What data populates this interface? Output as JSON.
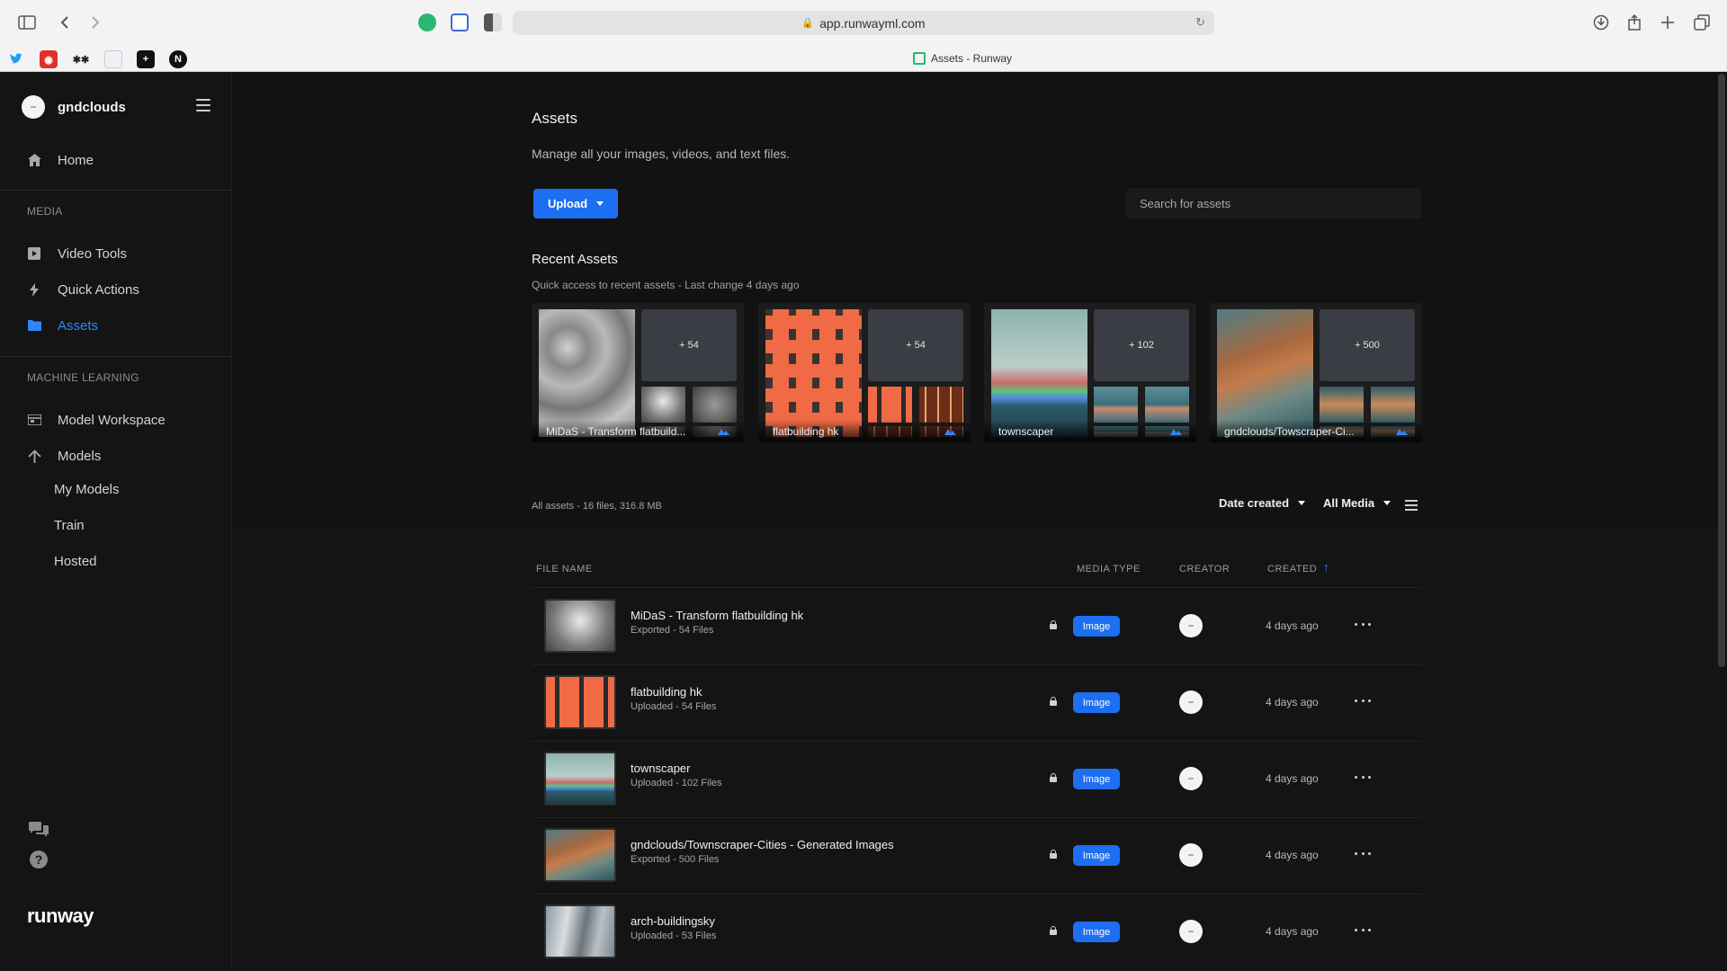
{
  "browser": {
    "url": "app.runwayml.com",
    "tab_title": "Assets - Runway"
  },
  "sidebar": {
    "username": "gndclouds",
    "home": "Home",
    "media_section": "MEDIA",
    "media_items": [
      {
        "label": "Video Tools",
        "icon": "video-icon"
      },
      {
        "label": "Quick Actions",
        "icon": "lightning-icon"
      },
      {
        "label": "Assets",
        "icon": "folder-icon",
        "active": true
      }
    ],
    "ml_section": "MACHINE LEARNING",
    "ml_items": [
      {
        "label": "Model Workspace",
        "icon": "workspace-icon"
      },
      {
        "label": "Models",
        "icon": "models-icon"
      }
    ],
    "model_sub_items": [
      "My Models",
      "Train",
      "Hosted"
    ],
    "brand": "runway"
  },
  "header": {
    "title": "Assets",
    "subtitle": "Manage all your images, videos, and text files.",
    "upload_label": "Upload",
    "search_placeholder": "Search for assets"
  },
  "recent": {
    "title": "Recent Assets",
    "subtitle": "Quick access to recent assets - Last change 4 days ago",
    "cards": [
      {
        "name": "MiDaS - Transform flatbuild...",
        "count": "+ 54"
      },
      {
        "name": "flatbuilding hk",
        "count": "+ 54"
      },
      {
        "name": "townscaper",
        "count": "+ 102"
      },
      {
        "name": "gndclouds/Towscraper-Ci...",
        "count": "+ 500"
      }
    ]
  },
  "list": {
    "summary": "All assets - 16 files, 316.8 MB",
    "sort_label": "Date created",
    "filter_label": "All Media",
    "columns": {
      "file_name": "FILE NAME",
      "media_type": "MEDIA TYPE",
      "creator": "CREATOR",
      "created": "CREATED"
    },
    "rows": [
      {
        "name": "MiDaS - Transform flatbuilding hk",
        "meta": "Exported - 54 Files",
        "type": "Image",
        "created": "4 days ago"
      },
      {
        "name": "flatbuilding hk",
        "meta": "Uploaded - 54 Files",
        "type": "Image",
        "created": "4 days ago"
      },
      {
        "name": "townscaper",
        "meta": "Uploaded - 102 Files",
        "type": "Image",
        "created": "4 days ago"
      },
      {
        "name": "gndclouds/Townscraper-Cities - Generated Images",
        "meta": "Exported - 500 Files",
        "type": "Image",
        "created": "4 days ago"
      },
      {
        "name": "arch-buildingsky",
        "meta": "Uploaded - 53 Files",
        "type": "Image",
        "created": "4 days ago"
      }
    ]
  },
  "colors": {
    "accent": "#1d6ff2",
    "background": "#121212",
    "sidebar": "#141414"
  }
}
